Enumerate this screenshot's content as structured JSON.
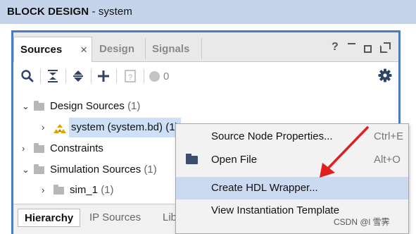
{
  "titlebar": {
    "title": "BLOCK DESIGN",
    "subtitle": " - system"
  },
  "tabs": [
    {
      "label": "Sources",
      "close": "×"
    },
    {
      "label": "Design"
    },
    {
      "label": "Signals"
    }
  ],
  "window_controls": {
    "help": "?"
  },
  "toolbar": {
    "counter": "0"
  },
  "tree": [
    {
      "label": "Design Sources",
      "count": "(1)"
    },
    {
      "label": "system (system.bd)",
      "count": "(1)"
    },
    {
      "label": "Constraints",
      "count": ""
    },
    {
      "label": "Simulation Sources",
      "count": "(1)"
    },
    {
      "label": "sim_1",
      "count": "(1)"
    }
  ],
  "bottom_tabs": [
    "Hierarchy",
    "IP Sources",
    "Lib"
  ],
  "context_menu": [
    {
      "label": "Source Node Properties...",
      "shortcut": "Ctrl+E"
    },
    {
      "label": "Open File",
      "shortcut": "Alt+O"
    },
    {
      "label": "Create HDL Wrapper...",
      "shortcut": ""
    },
    {
      "label": "View Instantiation Template",
      "shortcut": ""
    }
  ],
  "watermark": "CSDN @l 雪霁",
  "colors": {
    "accent": "#4a7cc0",
    "selection": "#cde0f7",
    "menu_hover": "#cbdaf1",
    "arrow": "#e02020"
  }
}
